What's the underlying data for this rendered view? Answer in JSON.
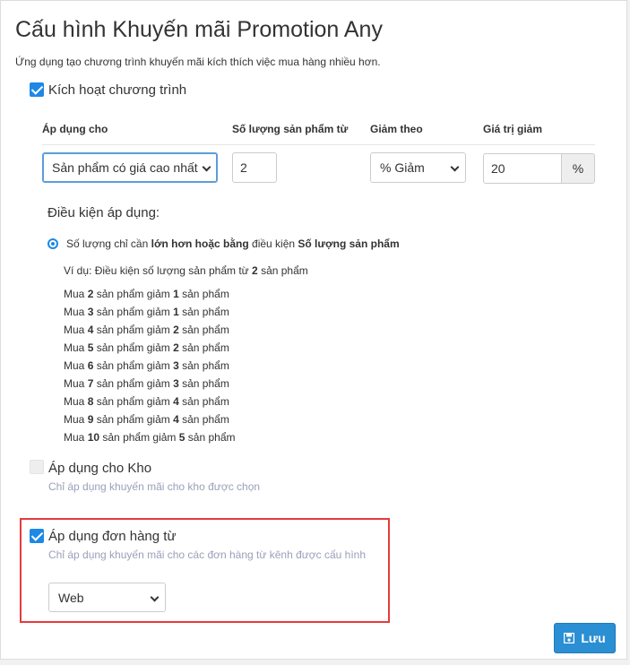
{
  "header": {
    "title": "Cấu hình Khuyến mãi Promotion Any",
    "subtitle": "Ứng dụng tạo chương trình khuyến mãi kích thích việc mua hàng nhiều hơn."
  },
  "activate": {
    "label": "Kích hoạt chương trình",
    "checked": true
  },
  "table": {
    "headers": {
      "apply_for": "Áp dụng cho",
      "quantity_from": "Số lượng sản phẩm từ",
      "discount_by": "Giảm theo",
      "discount_value": "Giá trị giảm"
    },
    "apply_for_value": "Sản phẩm có giá cao nhất",
    "quantity_value": "2",
    "discount_by_value": "% Giảm",
    "discount_value": "20",
    "discount_unit": "%"
  },
  "conditions": {
    "label": "Điều kiện áp dụng:",
    "rule_prefix": "Số lượng chỉ cần ",
    "rule_bold": "lớn hơn hoặc bằng",
    "rule_middle": " điều kiện ",
    "rule_bold2": "Số lượng sản phẩm",
    "example_prefix": "Ví dụ: Điều kiện số lượng sản phẩm từ ",
    "example_bold": "2",
    "example_suffix": " sản phẩm",
    "examples": [
      {
        "buy": "2",
        "get": "1"
      },
      {
        "buy": "3",
        "get": "1"
      },
      {
        "buy": "4",
        "get": "2"
      },
      {
        "buy": "5",
        "get": "2"
      },
      {
        "buy": "6",
        "get": "3"
      },
      {
        "buy": "7",
        "get": "3"
      },
      {
        "buy": "8",
        "get": "4"
      },
      {
        "buy": "9",
        "get": "4"
      },
      {
        "buy": "10",
        "get": "5"
      }
    ],
    "ex_buy": "Mua ",
    "ex_mid": " sản phẩm giảm ",
    "ex_end": " sản phẩm"
  },
  "warehouse": {
    "label": "Áp dụng cho Kho",
    "help": "Chỉ áp dụng khuyến mãi cho kho được chọn",
    "checked": false
  },
  "orders": {
    "label": "Áp dụng đơn hàng từ",
    "help": "Chỉ áp dụng khuyến mãi cho các đơn hàng từ kênh được cấu hình",
    "channel": "Web",
    "checked": true
  },
  "save_button": {
    "label": "Lưu",
    "icon": "floppy-disk-icon"
  },
  "colors": {
    "accent": "#1e88e5",
    "highlight": "#e43b3b",
    "button": "#2a8fd3"
  }
}
